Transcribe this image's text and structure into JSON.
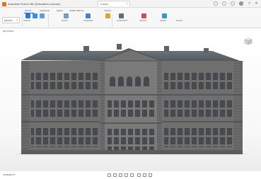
{
  "window": {
    "title": "Autodesk Fusion 360 (Education License)",
    "controls": [
      "–",
      "□",
      "✕"
    ]
  },
  "ribbon": {
    "tabs": [
      {
        "label": "SOLID",
        "active": true
      },
      {
        "label": "SURFACE",
        "active": false
      },
      {
        "label": "MESH",
        "active": false
      },
      {
        "label": "SHEET METAL",
        "active": false
      },
      {
        "label": "TOOLS",
        "active": false
      }
    ],
    "workspace": "DESIGN",
    "tools": [
      {
        "name": "new-component",
        "label": "CREATE",
        "color": "#2b7bd0"
      },
      {
        "name": "sketch",
        "label": "",
        "color": "#3e8fd8"
      },
      {
        "name": "extrude",
        "label": "",
        "color": "#5aa0dd"
      },
      {
        "name": "modify",
        "label": "MODIFY",
        "color": "#7c9ab5"
      },
      {
        "name": "assemble",
        "label": "ASSEMBLE",
        "color": "#4a83c4"
      },
      {
        "name": "construct",
        "label": "CONSTRUCT",
        "color": "#d9a43b"
      },
      {
        "name": "inspect",
        "label": "INSPECT",
        "color": "#5b6f85"
      },
      {
        "name": "insert",
        "label": "INSERT",
        "color": "#c94f4f"
      },
      {
        "name": "select",
        "label": "SELECT",
        "color": "#3b95c8"
      }
    ]
  },
  "document": {
    "tab_label": "Untitled*"
  },
  "browser": {
    "label": "BROWSER"
  },
  "statusbar": {
    "left": "COMMENTS",
    "right": ""
  },
  "colors": {
    "accent": "#0a6bb8",
    "facade": "#707070",
    "roof": "#5a6066",
    "window": "#3f4347"
  }
}
